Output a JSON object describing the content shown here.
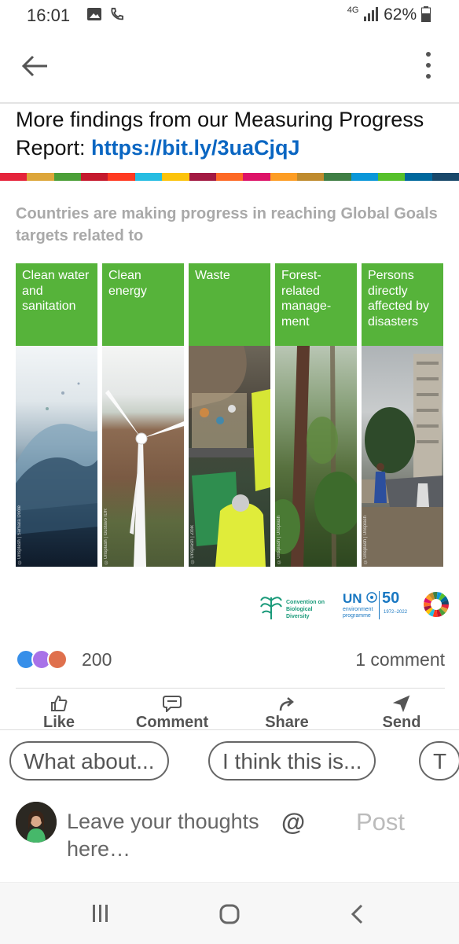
{
  "status": {
    "time": "16:01",
    "network": "4G",
    "battery": "62%"
  },
  "post": {
    "title_prefix": "More findings from our Measuring Progress Report: ",
    "link": "https://bit.ly/3uaCjqJ"
  },
  "sdg_colors": [
    "#e5243b",
    "#dda63a",
    "#4c9f38",
    "#c5192d",
    "#ff3a21",
    "#26bde2",
    "#fcc30b",
    "#a21942",
    "#fd6925",
    "#dd1367",
    "#fd9d24",
    "#bf8b2e",
    "#3f7e44",
    "#0a97d9",
    "#56c02b",
    "#00689d",
    "#19486a"
  ],
  "infographic": {
    "headline": "Countries are making progress in reaching Global Goals targets related to",
    "cards": [
      {
        "label": "Clean water and sanitation",
        "credit": "©Unsplash | Samara Doole"
      },
      {
        "label": "Clean energy",
        "credit": "©Unsplash | Gustavo IDR"
      },
      {
        "label": "Waste",
        "credit": "©Unsplash | Zibik"
      },
      {
        "label": "Forest-related manage-ment",
        "credit": "©Unsplash | Unsplash"
      },
      {
        "label": "Persons directly affected by disasters",
        "credit": "©Unsplash | Unsplash"
      }
    ],
    "logo_cbd": "Convention on Biological Diversity",
    "logo_un": "UN",
    "logo_unep": "environment programme",
    "logo_50": "50",
    "logo_years": "1972–2022"
  },
  "social": {
    "reaction_count": "200",
    "comment_count": "1 comment"
  },
  "actions": {
    "like": "Like",
    "comment": "Comment",
    "share": "Share",
    "send": "Send"
  },
  "chips": [
    "What about...",
    "I think this is...",
    "T"
  ],
  "composer": {
    "placeholder": "Leave your thoughts here…",
    "mention": "@",
    "post": "Post"
  },
  "accent": "#0a66c2",
  "green": "#56b33a"
}
